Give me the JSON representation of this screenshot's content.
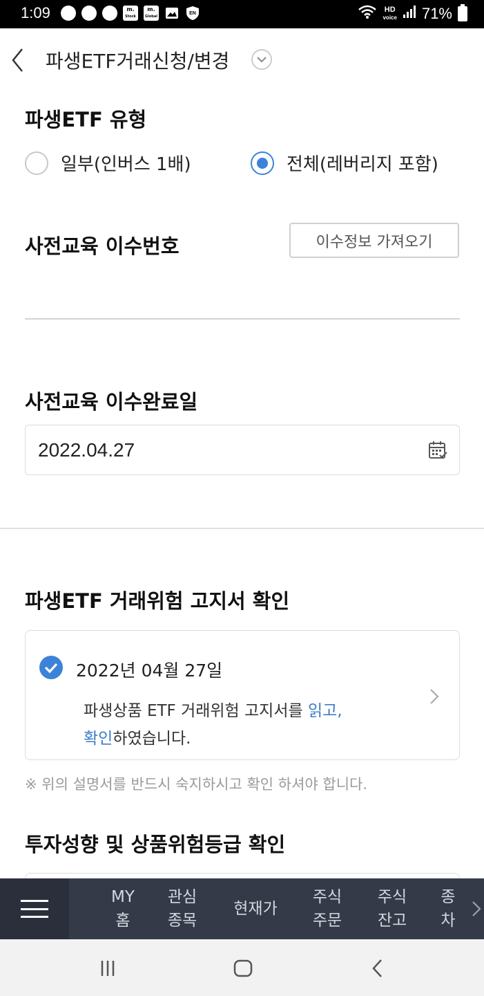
{
  "status_bar": {
    "time": "1:09",
    "hd_label": "HD",
    "voice_label": "voice",
    "battery": "71%",
    "notification_icons": [
      "chat-bubble-icon",
      "chat-bubble-icon",
      "chat-bubble-icon",
      "mstock-app-icon",
      "mglobal-app-icon",
      "image-icon",
      "en-shield-icon"
    ],
    "mstock_label": "m.",
    "mstock_sub": "Stock",
    "mglobal_label": "m.",
    "mglobal_sub": "Global",
    "en_label": "EN"
  },
  "header": {
    "title": "파생ETF거래신청/변경"
  },
  "etf_type": {
    "title": "파생ETF 유형",
    "options": [
      {
        "label": "일부(인버스 1배)",
        "selected": false
      },
      {
        "label": "전체(레버리지 포함)",
        "selected": true
      }
    ]
  },
  "education_number": {
    "title": "사전교육 이수번호",
    "fetch_button": "이수정보 가져오기",
    "value": ""
  },
  "education_date": {
    "title": "사전교육 이수완료일",
    "value": "2022.04.27"
  },
  "risk_notice": {
    "title": "파생ETF 거래위험 고지서 확인",
    "checked_date": "2022년 04월 27일",
    "text_before": "파생상품 ETF 거래위험 고지서를 ",
    "link_read": "읽고,",
    "link_confirm": "확인",
    "text_after": "하였습니다.",
    "footnote": "※ 위의 설명서를 반드시 숙지하시고 확인 하셔야 합니다."
  },
  "next_section": {
    "title": "투자성향 및 상품위험등급 확인"
  },
  "bottom_nav": {
    "items": [
      {
        "line1": "MY",
        "line2": "홈"
      },
      {
        "line1": "관심",
        "line2": "종목"
      },
      {
        "line1": "현재가",
        "line2": ""
      },
      {
        "line1": "주식",
        "line2": "주문"
      },
      {
        "line1": "주식",
        "line2": "잔고"
      },
      {
        "line1": "종",
        "line2": "차"
      }
    ]
  },
  "colors": {
    "accent": "#3c82d8",
    "toolbar_bg": "#343a48",
    "link": "#3c7bc8"
  }
}
